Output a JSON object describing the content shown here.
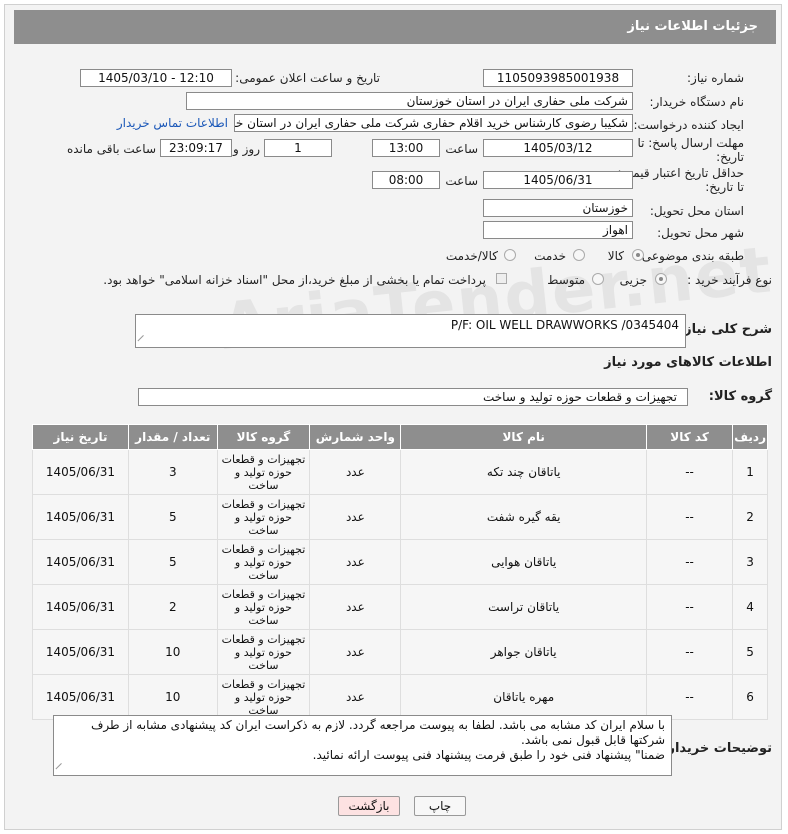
{
  "header": {
    "title": "جزئیات اطلاعات نیاز"
  },
  "form": {
    "need_number": {
      "label": "شماره نیاز:",
      "value": "1105093985001938"
    },
    "announce": {
      "label": "تاریخ و ساعت اعلان عمومی:",
      "value": "1405/03/10 - 12:10"
    },
    "buyer_org": {
      "label": "نام دستگاه خریدار:",
      "value": "شرکت ملی حفاری ایران در استان خوزستان"
    },
    "creator": {
      "label": "ایجاد کننده درخواست:",
      "value": "شکیبا رضوی کارشناس خرید اقلام حفاری شرکت ملی حفاری ایران در استان خو",
      "link": "اطلاعات تماس خریدار"
    },
    "reply_deadline": {
      "label_line1": "مهلت ارسال پاسخ: تا",
      "label_line2": "تاریخ:",
      "date": "1405/03/12",
      "time_label": "ساعت",
      "time": "13:00",
      "days": "1",
      "days_label": "روز و",
      "remaining": "23:09:17",
      "remaining_label": "ساعت باقی مانده"
    },
    "price_validity": {
      "label_line1": "حداقل تاریخ اعتبار قیمت:",
      "label_line2": "تا تاریخ:",
      "date": "1405/06/31",
      "time_label": "ساعت",
      "time": "08:00"
    },
    "province": {
      "label": "استان محل تحویل:",
      "value": "خوزستان"
    },
    "city": {
      "label": "شهر محل تحویل:",
      "value": "اهواز"
    },
    "category": {
      "label": "طبقه بندی موضوعی:",
      "options": [
        "کالا",
        "خدمت",
        "کالا/خدمت"
      ]
    },
    "process": {
      "label": "نوع فرآیند خرید :",
      "options": [
        "جزیی",
        "متوسط"
      ],
      "note": "پرداخت تمام یا بخشی از مبلغ خرید،از محل \"اسناد خزانه اسلامی\" خواهد بود."
    }
  },
  "description": {
    "label": "شرح کلی نیاز:",
    "value": "P/F: OIL WELL DRAWWORKS /0345404"
  },
  "goods_info": {
    "title": "اطلاعات کالاهای مورد نیاز"
  },
  "goods_group": {
    "label": "گروه کالا:",
    "value": "تجهیزات و قطعات حوزه تولید و ساخت"
  },
  "table": {
    "headers": [
      "ردیف",
      "کد کالا",
      "نام کالا",
      "واحد شمارش",
      "گروه کالا",
      "تعداد / مقدار",
      "تاریخ نیاز"
    ],
    "rows": [
      {
        "idx": "1",
        "code": "--",
        "name": "یاتاقان چند تکه",
        "unit": "عدد",
        "group": "تجهیزات و قطعات حوزه تولید و ساخت",
        "qty": "3",
        "date": "1405/06/31"
      },
      {
        "idx": "2",
        "code": "--",
        "name": "یقه گیره شفت",
        "unit": "عدد",
        "group": "تجهیزات و قطعات حوزه تولید و ساخت",
        "qty": "5",
        "date": "1405/06/31"
      },
      {
        "idx": "3",
        "code": "--",
        "name": "یاتاقان هوایی",
        "unit": "عدد",
        "group": "تجهیزات و قطعات حوزه تولید و ساخت",
        "qty": "5",
        "date": "1405/06/31"
      },
      {
        "idx": "4",
        "code": "--",
        "name": "یاتاقان تراست",
        "unit": "عدد",
        "group": "تجهیزات و قطعات حوزه تولید و ساخت",
        "qty": "2",
        "date": "1405/06/31"
      },
      {
        "idx": "5",
        "code": "--",
        "name": "یاتاقان جواهر",
        "unit": "عدد",
        "group": "تجهیزات و قطعات حوزه تولید و ساخت",
        "qty": "10",
        "date": "1405/06/31"
      },
      {
        "idx": "6",
        "code": "--",
        "name": "مهره یاتاقان",
        "unit": "عدد",
        "group": "تجهیزات و قطعات حوزه تولید و ساخت",
        "qty": "10",
        "date": "1405/06/31"
      }
    ]
  },
  "buyer_notes": {
    "label": "توضیحات خریدار:",
    "lines": [
      "با سلام ایران کد مشابه می باشد. لطفا به پیوست مراجعه گردد. لازم به ذکراست ایران کد پیشنهادی مشابه از طرف",
      "شرکتها قابل قبول نمی باشد.",
      "ضمنا\" پیشنهاد فنی خود را طبق فرمت پیشنهاد فنی پیوست ارائه نمائید."
    ]
  },
  "buttons": {
    "print": "چاپ",
    "back": "بازگشت"
  }
}
